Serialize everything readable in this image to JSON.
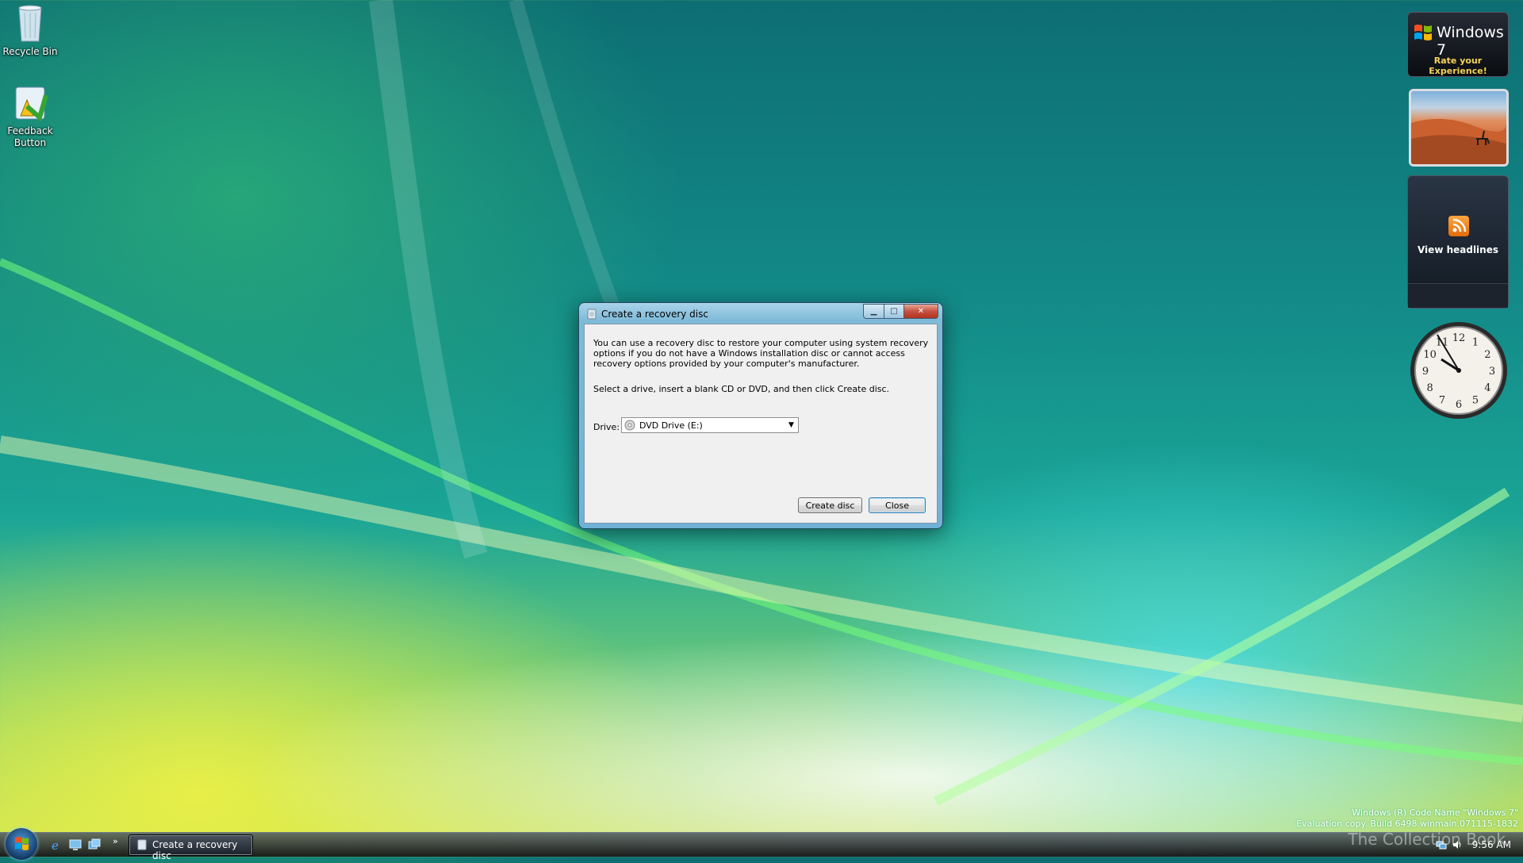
{
  "desktop": {
    "icons": [
      {
        "label": "Recycle Bin"
      },
      {
        "label": "Feedback\nButton"
      }
    ]
  },
  "gadgets": {
    "rating": {
      "title": "Windows 7",
      "subtitle": "Rate your Experience!"
    },
    "feed": {
      "label": "View headlines"
    },
    "clock": {
      "numbers": [
        "12",
        "1",
        "2",
        "3",
        "4",
        "5",
        "6",
        "7",
        "8",
        "9",
        "10",
        "11"
      ]
    }
  },
  "dialog": {
    "title": "Create a recovery disc",
    "description": "You can use a recovery disc to restore your computer using system recovery options if you do not have a Windows installation disc or cannot access recovery options provided by your computer's manufacturer.",
    "instruction": "Select a drive, insert a blank CD or DVD, and then click Create disc.",
    "drive_label": "Drive:",
    "drive_value": "DVD Drive (E:)",
    "create_button": "Create disc",
    "close_button": "Close"
  },
  "taskbar": {
    "chevron": "»",
    "active_task": "Create a recovery disc",
    "time": "9:56 AM"
  },
  "watermark": {
    "line1": "Windows (R) Code Name \"Windows 7\"",
    "line2": "Evaluation copy. Build 6498.winmain.071115-1832",
    "brand": "The Collection Book"
  },
  "colors": {
    "dialog_frame": "#7fbad8",
    "close_button": "#c75140",
    "gadget_text_accent": "#f6d35a"
  }
}
